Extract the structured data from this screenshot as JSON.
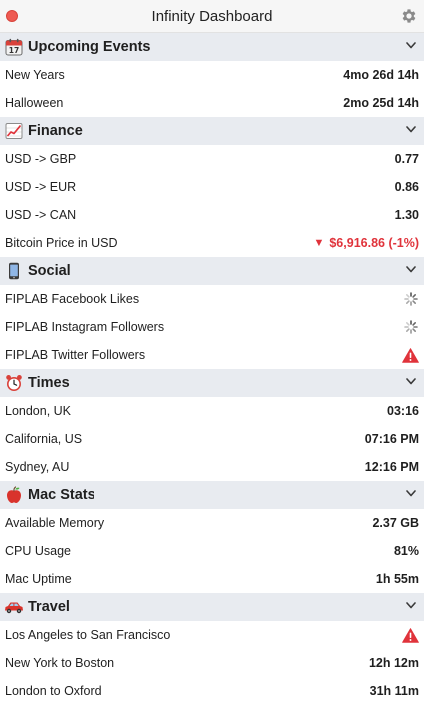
{
  "window": {
    "title": "Infinity Dashboard"
  },
  "icons": {
    "close": "close-dot",
    "settings": "gear-icon",
    "collapse": "chevron-down-icon",
    "loading": "spinner-icon",
    "error": "warning-icon"
  },
  "colors": {
    "section_header_bg": "#e8ebf0",
    "negative": "#e0333b",
    "close_button": "#ee5a52"
  },
  "sections": {
    "upcoming": {
      "title": "Upcoming Events",
      "icon": "calendar-icon",
      "rows": [
        {
          "label": "New Years",
          "value": "4mo 26d 14h"
        },
        {
          "label": "Halloween",
          "value": "2mo 25d 14h"
        }
      ]
    },
    "finance": {
      "title": "Finance",
      "icon": "chart-icon",
      "rows": [
        {
          "label": "USD -> GBP",
          "value": "0.77"
        },
        {
          "label": "USD -> EUR",
          "value": "0.86"
        },
        {
          "label": "USD -> CAN",
          "value": "1.30"
        },
        {
          "label": "Bitcoin Price in USD",
          "value": "$6,916.86 (-1%)",
          "trend": "down"
        }
      ]
    },
    "social": {
      "title": "Social",
      "icon": "phone-icon",
      "rows": [
        {
          "label": "FIPLAB Facebook Likes",
          "status": "loading"
        },
        {
          "label": "FIPLAB Instagram Followers",
          "status": "loading"
        },
        {
          "label": "FIPLAB Twitter Followers",
          "status": "error"
        }
      ]
    },
    "times": {
      "title": "Times",
      "icon": "alarm-clock-icon",
      "rows": [
        {
          "label": "London, UK",
          "value": "03:16"
        },
        {
          "label": "California, US",
          "value": "07:16 PM"
        },
        {
          "label": "Sydney, AU",
          "value": "12:16 PM"
        }
      ]
    },
    "mac": {
      "title": "Mac Stats",
      "icon": "apple-icon",
      "rows": [
        {
          "label": "Available Memory",
          "value": "2.37 GB"
        },
        {
          "label": "CPU Usage",
          "value": "81%"
        },
        {
          "label": "Mac Uptime",
          "value": "1h 55m"
        }
      ]
    },
    "travel": {
      "title": "Travel",
      "icon": "car-icon",
      "rows": [
        {
          "label": "Los Angeles to San Francisco",
          "status": "error"
        },
        {
          "label": "New York to Boston",
          "value": "12h 12m"
        },
        {
          "label": "London to Oxford",
          "value": "31h 11m"
        }
      ]
    }
  }
}
